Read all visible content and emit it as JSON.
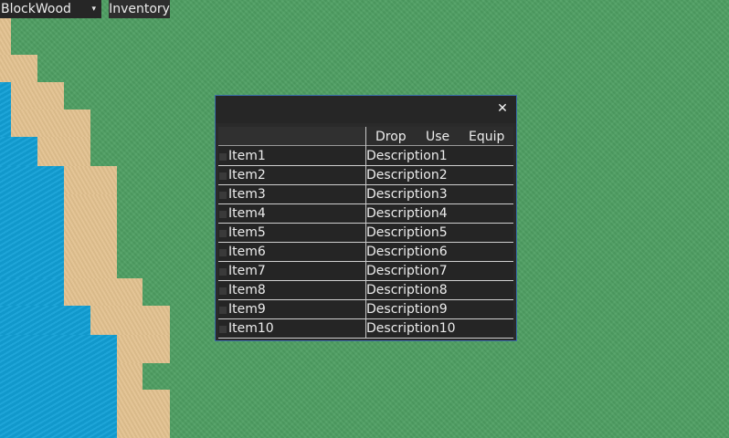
{
  "toolbar": {
    "block_select": {
      "selected": "BlockWood",
      "arrow_icon": "▾"
    },
    "inventory_button": "Inventory"
  },
  "inventory_window": {
    "close_icon": "✕",
    "columns": {
      "drop": "Drop",
      "use": "Use",
      "equip": "Equip"
    },
    "items": [
      {
        "name": "Item1",
        "description": "Description1"
      },
      {
        "name": "Item2",
        "description": "Description2"
      },
      {
        "name": "Item3",
        "description": "Description3"
      },
      {
        "name": "Item4",
        "description": "Description4"
      },
      {
        "name": "Item5",
        "description": "Description5"
      },
      {
        "name": "Item6",
        "description": "Description6"
      },
      {
        "name": "Item7",
        "description": "Description7"
      },
      {
        "name": "Item8",
        "description": "Description8"
      },
      {
        "name": "Item9",
        "description": "Description9"
      },
      {
        "name": "Item10",
        "description": "Description10"
      }
    ]
  },
  "colors": {
    "grass": "#4fa063",
    "sand": "#e2c18f",
    "water": "#12a0d6",
    "window_border": "#3a6ea8",
    "panel": "#262626"
  }
}
